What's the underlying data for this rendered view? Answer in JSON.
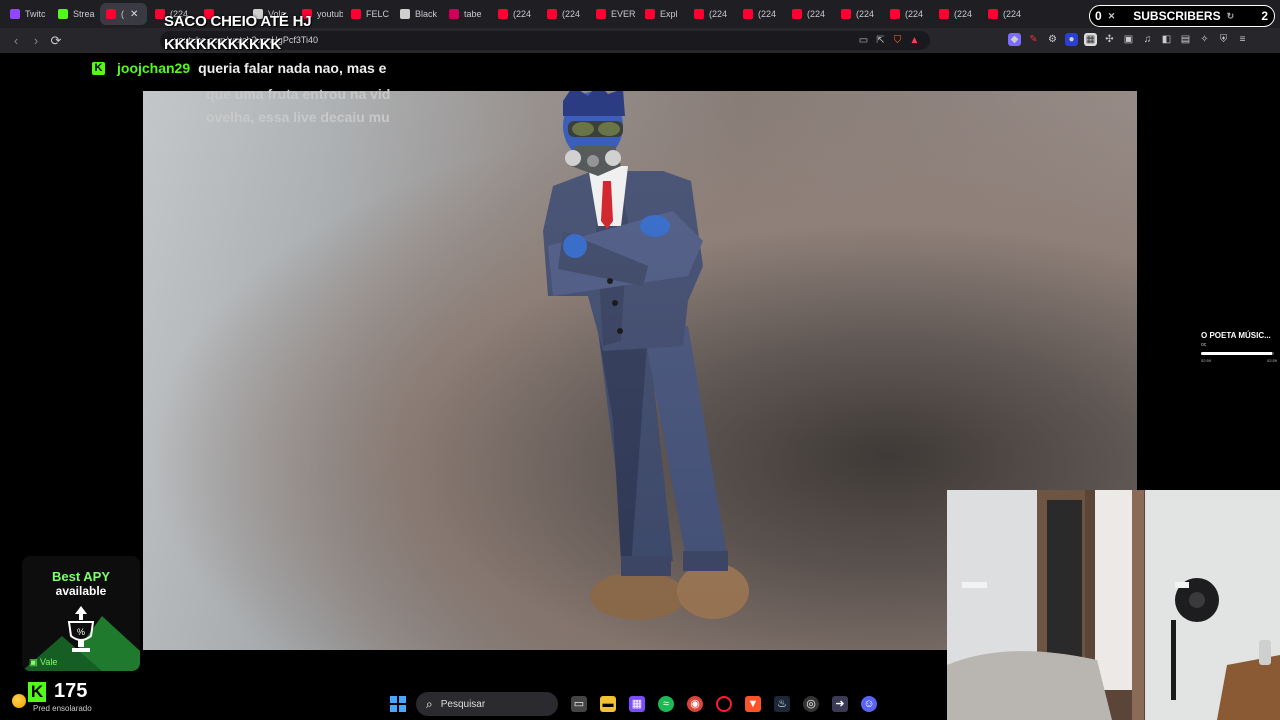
{
  "browser": {
    "tabs": [
      {
        "label": "Twitc",
        "color": "#9146ff"
      },
      {
        "label": "Strea",
        "color": "#53fc18"
      },
      {
        "label": "(",
        "color": "#ff0033",
        "active": true
      },
      {
        "label": "(224",
        "color": "#ff0033"
      },
      {
        "label": "",
        "color": "#ff0033"
      },
      {
        "label": "Vola",
        "color": "#cfcfcf"
      },
      {
        "label": "youtube",
        "color": "#ff0033"
      },
      {
        "label": "FELC",
        "color": "#ff0033"
      },
      {
        "label": "Black",
        "color": "#cfcfcf"
      },
      {
        "label": "tabe",
        "color": "#d0005a"
      },
      {
        "label": "(224",
        "color": "#ff0033"
      },
      {
        "label": "(224",
        "color": "#ff0033"
      },
      {
        "label": "EVER",
        "color": "#ff0033"
      },
      {
        "label": "Expl",
        "color": "#ff0033"
      },
      {
        "label": "(224",
        "color": "#ff0033"
      },
      {
        "label": "(224",
        "color": "#ff0033"
      },
      {
        "label": "(224",
        "color": "#ff0033"
      },
      {
        "label": "(224",
        "color": "#ff0033"
      },
      {
        "label": "(224",
        "color": "#ff0033"
      },
      {
        "label": "(224",
        "color": "#ff0033"
      },
      {
        "label": "(224",
        "color": "#ff0033"
      }
    ],
    "url": "youtube.com/watch?v=nHgPcf3Ti40"
  },
  "alert": {
    "line1": "SACO CHEIO ATÉ HJ",
    "line2": "KKKKKKKKKKK"
  },
  "subs": {
    "left_count": "0",
    "label": "SUBSCRIBERS",
    "right_count": "2"
  },
  "chat": {
    "username": "joojchan29",
    "line1": "queria falar nada nao, mas e",
    "line2": "que uma fruta entrou na vid",
    "line3": "ovelha, essa live decaiu mu"
  },
  "music": {
    "title": "O POETA MÚSIC...",
    "artist": "oc",
    "time_left": "02:59",
    "time_right": "02:59",
    "progress": 0.97
  },
  "promo": {
    "line1": "Best APY",
    "line2": "available",
    "footer": "Vale"
  },
  "kick_score": {
    "value": "175",
    "weather": "Pred ensolarado"
  },
  "taskbar": {
    "search_placeholder": "Pesquisar"
  }
}
